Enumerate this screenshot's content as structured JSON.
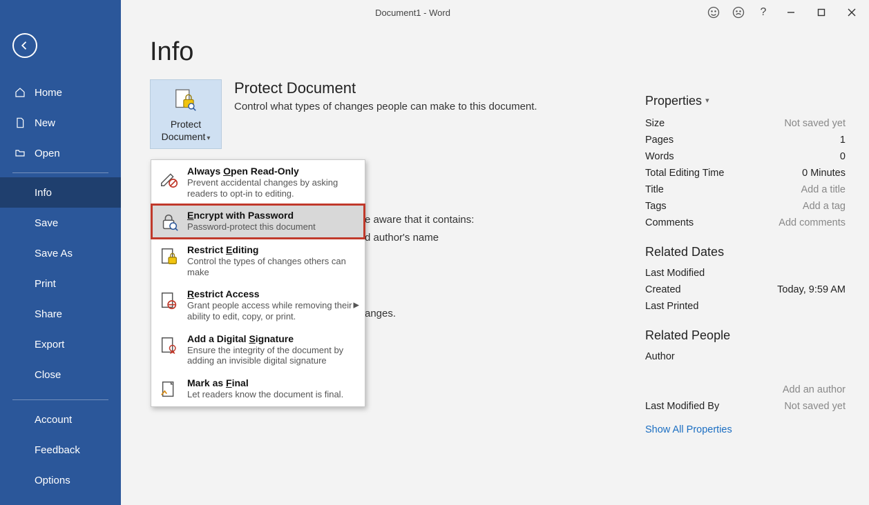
{
  "titlebar": {
    "title": "Document1  -  Word",
    "help": "?",
    "smile": "☺",
    "frown": "☹"
  },
  "sidebar": {
    "home": "Home",
    "new": "New",
    "open": "Open",
    "info": "Info",
    "save": "Save",
    "saveas": "Save As",
    "print": "Print",
    "share": "Share",
    "export": "Export",
    "close": "Close",
    "account": "Account",
    "feedback": "Feedback",
    "options": "Options"
  },
  "page": {
    "title": "Info"
  },
  "protect": {
    "btn_label": "Protect Document",
    "section_title": "Protect Document",
    "section_desc": "Control what types of changes people can make to this document."
  },
  "dropdown": {
    "readonly": {
      "title_pre": "Always ",
      "title_u": "O",
      "title_post": "pen Read-Only",
      "desc": "Prevent accidental changes by asking readers to opt-in to editing."
    },
    "encrypt": {
      "title_pre": "",
      "title_u": "E",
      "title_post": "ncrypt with Password",
      "desc": "Password-protect this document"
    },
    "restrict": {
      "title_pre": "Restrict ",
      "title_u": "E",
      "title_post": "diting",
      "desc": "Control the types of changes others can make"
    },
    "access": {
      "title_pre": "",
      "title_u": "R",
      "title_post": "estrict Access",
      "desc": "Grant people access while removing their ability to edit, copy, or print."
    },
    "digsig": {
      "title_pre": "Add a Digital ",
      "title_u": "S",
      "title_post": "ignature",
      "desc": "Ensure the integrity of the document by adding an invisible digital signature"
    },
    "final": {
      "title_pre": "Mark as ",
      "title_u": "F",
      "title_post": "inal",
      "desc": "Let readers know the document is final."
    }
  },
  "behind": {
    "inspect_line1": "e aware that it contains:",
    "inspect_line2": "d author's name",
    "manage_line": "anges."
  },
  "props": {
    "header": "Properties",
    "size": {
      "label": "Size",
      "value": "Not saved yet"
    },
    "pages": {
      "label": "Pages",
      "value": "1"
    },
    "words": {
      "label": "Words",
      "value": "0"
    },
    "editing": {
      "label": "Total Editing Time",
      "value": "0 Minutes"
    },
    "title": {
      "label": "Title",
      "value": "Add a title"
    },
    "tags": {
      "label": "Tags",
      "value": "Add a tag"
    },
    "comments": {
      "label": "Comments",
      "value": "Add comments"
    },
    "dates_header": "Related Dates",
    "lastmod": {
      "label": "Last Modified",
      "value": ""
    },
    "created": {
      "label": "Created",
      "value": "Today, 9:59 AM"
    },
    "lastprinted": {
      "label": "Last Printed",
      "value": ""
    },
    "people_header": "Related People",
    "author": {
      "label": "Author",
      "value": ""
    },
    "addauthor": "Add an author",
    "lastmodby": {
      "label": "Last Modified By",
      "value": "Not saved yet"
    },
    "showall": "Show All Properties"
  }
}
